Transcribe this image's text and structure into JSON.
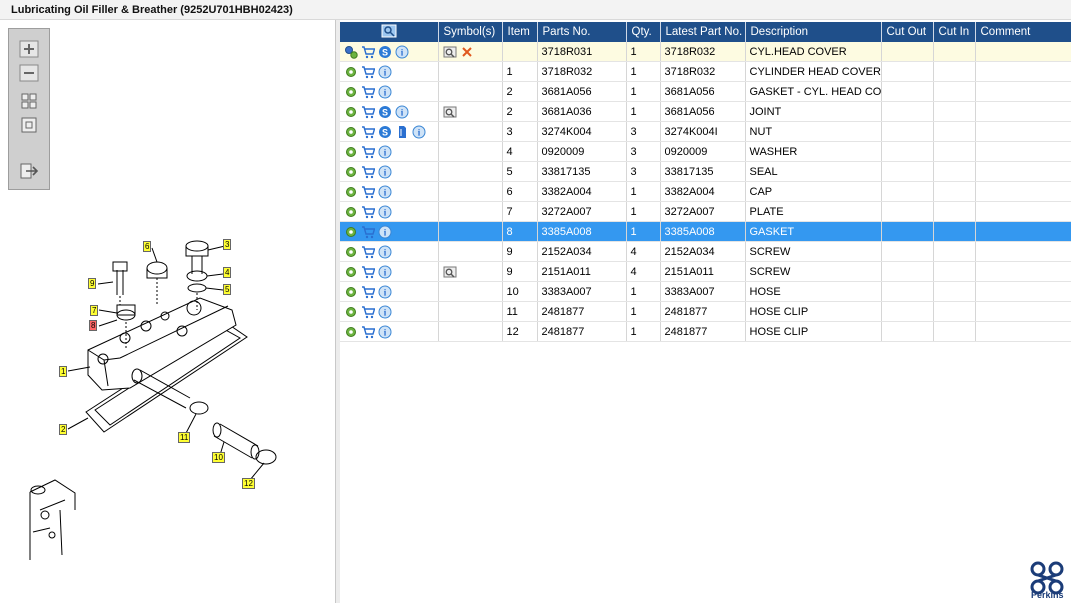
{
  "window": {
    "title": "Lubricating Oil Filler & Breather (9252U701HBH02423)"
  },
  "toolbar": {
    "icons": [
      "zoom-in-icon",
      "zoom-out-icon",
      "fit-page-icon",
      "actual-size-icon",
      "export-icon"
    ]
  },
  "diagram": {
    "callouts": [
      "1",
      "2",
      "3",
      "4",
      "5",
      "6",
      "7",
      "8",
      "9",
      "10",
      "11",
      "12"
    ]
  },
  "table": {
    "headers": {
      "col0_icon": "search-parts-icon",
      "symbols": "Symbol(s)",
      "item": "Item",
      "parts_no": "Parts No.",
      "qty": "Qty.",
      "latest_part_no": "Latest Part No.",
      "description": "Description",
      "cut_out": "Cut Out",
      "cut_in": "Cut In",
      "comment": "Comment"
    },
    "rows": [
      {
        "item": "",
        "parts_no": "3718R031",
        "qty": "1",
        "latest": "3718R032",
        "description": "CYL.HEAD COVER",
        "flags": [
          "gears",
          "cart",
          "s",
          "info"
        ],
        "symbols": [
          "binoculars",
          "x"
        ],
        "state": "highlight"
      },
      {
        "item": "1",
        "parts_no": "3718R032",
        "qty": "1",
        "latest": "3718R032",
        "description": "CYLINDER HEAD COVER",
        "flags": [
          "gear",
          "cart",
          "info"
        ],
        "symbols": [],
        "state": ""
      },
      {
        "item": "2",
        "parts_no": "3681A056",
        "qty": "1",
        "latest": "3681A056",
        "description": "GASKET - CYL. HEAD COVE",
        "flags": [
          "gear",
          "cart",
          "info"
        ],
        "symbols": [],
        "state": ""
      },
      {
        "item": "2",
        "parts_no": "3681A036",
        "qty": "1",
        "latest": "3681A056",
        "description": "JOINT",
        "flags": [
          "gear",
          "cart",
          "s",
          "info"
        ],
        "symbols": [
          "binoculars"
        ],
        "state": ""
      },
      {
        "item": "3",
        "parts_no": "3274K004",
        "qty": "3",
        "latest": "3274K004I",
        "description": "NUT",
        "flags": [
          "gear",
          "cart",
          "s",
          "doc",
          "info"
        ],
        "symbols": [],
        "state": ""
      },
      {
        "item": "4",
        "parts_no": "0920009",
        "qty": "3",
        "latest": "0920009",
        "description": "WASHER",
        "flags": [
          "gear",
          "cart",
          "info"
        ],
        "symbols": [],
        "state": ""
      },
      {
        "item": "5",
        "parts_no": "33817135",
        "qty": "3",
        "latest": "33817135",
        "description": "SEAL",
        "flags": [
          "gear",
          "cart",
          "info"
        ],
        "symbols": [],
        "state": ""
      },
      {
        "item": "6",
        "parts_no": "3382A004",
        "qty": "1",
        "latest": "3382A004",
        "description": "CAP",
        "flags": [
          "gear",
          "cart",
          "info"
        ],
        "symbols": [],
        "state": ""
      },
      {
        "item": "7",
        "parts_no": "3272A007",
        "qty": "1",
        "latest": "3272A007",
        "description": "PLATE",
        "flags": [
          "gear",
          "cart",
          "info"
        ],
        "symbols": [],
        "state": ""
      },
      {
        "item": "8",
        "parts_no": "3385A008",
        "qty": "1",
        "latest": "3385A008",
        "description": "GASKET",
        "flags": [
          "gear",
          "cart",
          "info"
        ],
        "symbols": [],
        "state": "selected"
      },
      {
        "item": "9",
        "parts_no": "2152A034",
        "qty": "4",
        "latest": "2152A034",
        "description": "SCREW",
        "flags": [
          "gear",
          "cart",
          "info"
        ],
        "symbols": [],
        "state": ""
      },
      {
        "item": "9",
        "parts_no": "2151A011",
        "qty": "4",
        "latest": "2151A011",
        "description": "SCREW",
        "flags": [
          "gear",
          "cart",
          "info"
        ],
        "symbols": [
          "binoculars"
        ],
        "state": ""
      },
      {
        "item": "10",
        "parts_no": "3383A007",
        "qty": "1",
        "latest": "3383A007",
        "description": "HOSE",
        "flags": [
          "gear",
          "cart",
          "info"
        ],
        "symbols": [],
        "state": ""
      },
      {
        "item": "11",
        "parts_no": "2481877",
        "qty": "1",
        "latest": "2481877",
        "description": "HOSE CLIP",
        "flags": [
          "gear",
          "cart",
          "info"
        ],
        "symbols": [],
        "state": ""
      },
      {
        "item": "12",
        "parts_no": "2481877",
        "qty": "1",
        "latest": "2481877",
        "description": "HOSE CLIP",
        "flags": [
          "gear",
          "cart",
          "info"
        ],
        "symbols": [],
        "state": ""
      }
    ]
  },
  "brand": {
    "logo_text": "Perkins",
    "color": "#1b3c78"
  },
  "colors": {
    "header": "#1f4f8a",
    "selected_row": "#3498f0",
    "highlight_row": "#fdfbe1",
    "callout_yellow": "#ffff33",
    "callout_red": "#ff6666"
  }
}
